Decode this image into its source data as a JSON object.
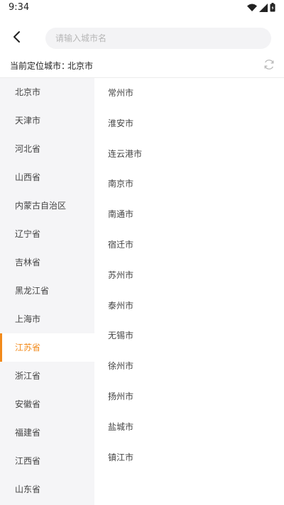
{
  "status_bar": {
    "time": "9:34",
    "icons": [
      "wifi-icon",
      "cell-signal-icon",
      "battery-icon"
    ]
  },
  "header": {
    "back_icon": "chevron-left-icon",
    "search_placeholder": "请输入城市名"
  },
  "location": {
    "label": "当前定位城市：",
    "city": "北京市",
    "refresh_icon": "refresh-icon"
  },
  "provinces": [
    {
      "label": "北京市"
    },
    {
      "label": "天津市"
    },
    {
      "label": "河北省"
    },
    {
      "label": "山西省"
    },
    {
      "label": "内蒙古自治区"
    },
    {
      "label": "辽宁省"
    },
    {
      "label": "吉林省"
    },
    {
      "label": "黑龙江省"
    },
    {
      "label": "上海市"
    },
    {
      "label": "江苏省"
    },
    {
      "label": "浙江省"
    },
    {
      "label": "安徽省"
    },
    {
      "label": "福建省"
    },
    {
      "label": "江西省"
    },
    {
      "label": "山东省"
    }
  ],
  "selected_province_index": 9,
  "cities": [
    {
      "label": "常州市"
    },
    {
      "label": "淮安市"
    },
    {
      "label": "连云港市"
    },
    {
      "label": "南京市"
    },
    {
      "label": "南通市"
    },
    {
      "label": "宿迁市"
    },
    {
      "label": "苏州市"
    },
    {
      "label": "泰州市"
    },
    {
      "label": "无锡市"
    },
    {
      "label": "徐州市"
    },
    {
      "label": "扬州市"
    },
    {
      "label": "盐城市"
    },
    {
      "label": "镇江市"
    }
  ],
  "colors": {
    "accent": "#f28a1b",
    "sidebar_bg": "#f5f5f7",
    "search_bg": "#f3f3f5"
  }
}
